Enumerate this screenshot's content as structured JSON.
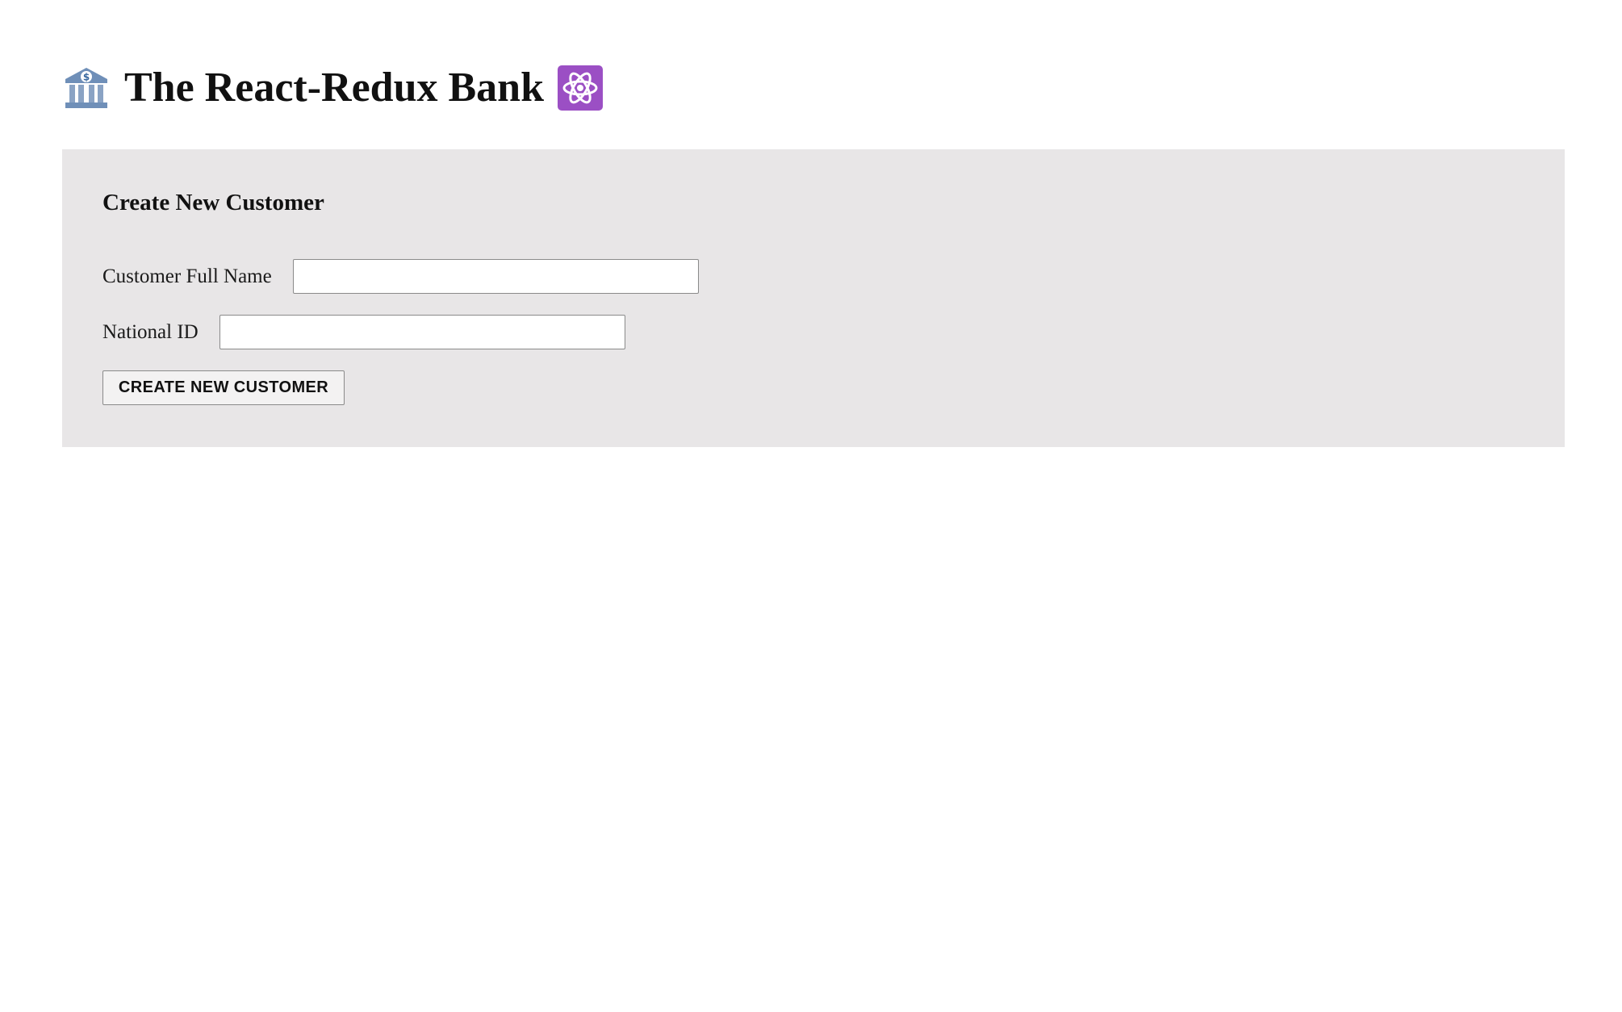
{
  "header": {
    "title": "The React-Redux Bank",
    "left_icon": "bank-icon",
    "right_icon": "atom-icon"
  },
  "create_customer": {
    "title": "Create New Customer",
    "full_name_label": "Customer Full Name",
    "full_name_value": "",
    "national_id_label": "National ID",
    "national_id_value": "",
    "submit_label": "CREATE NEW CUSTOMER"
  },
  "colors": {
    "page_background": "#ffffff",
    "panel_background": "#e8e6e7",
    "atom_icon_background": "#9b4fc4",
    "bank_icon_color": "#5b7fa8"
  }
}
